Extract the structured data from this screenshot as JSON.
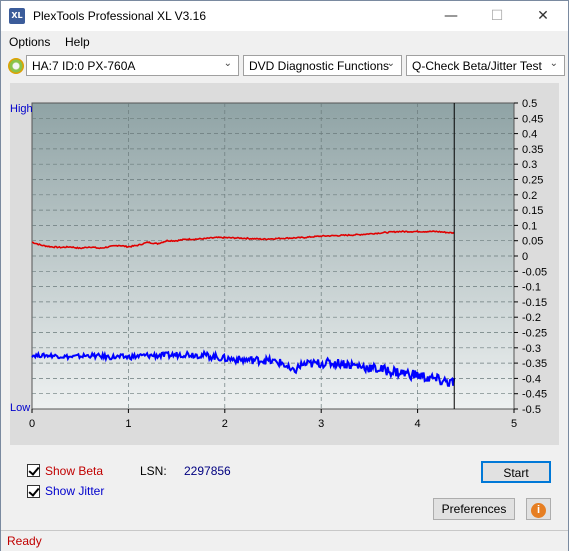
{
  "window": {
    "title": "PlexTools Professional XL V3.16",
    "app_icon_text": "XL"
  },
  "menu": {
    "options": "Options",
    "help": "Help"
  },
  "toolbar": {
    "drive": "HA:7 ID:0  PX-760A",
    "function": "DVD Diagnostic Functions",
    "test": "Q-Check Beta/Jitter Test"
  },
  "controls": {
    "show_beta": "Show Beta",
    "show_jitter": "Show Jitter",
    "show_beta_checked": true,
    "show_jitter_checked": true,
    "lsn_label": "LSN:",
    "lsn_value": "2297856",
    "start": "Start",
    "preferences": "Preferences"
  },
  "status": {
    "text": "Ready"
  },
  "colors": {
    "beta": "#e00000",
    "jitter": "#0000ff",
    "plot_top": "#8fa3a5",
    "plot_bottom": "#e8ecec",
    "left_label": "#0000cc"
  },
  "chart_data": {
    "type": "line",
    "left_axis_labels": {
      "high": "High",
      "low": "Low"
    },
    "x_ticks": [
      "0",
      "1",
      "2",
      "3",
      "4",
      "5"
    ],
    "xlim": [
      0,
      5
    ],
    "y_ticks": [
      "0.5",
      "0.45",
      "0.4",
      "0.35",
      "0.3",
      "0.25",
      "0.2",
      "0.15",
      "0.1",
      "0.05",
      "0",
      "-0.05",
      "-0.1",
      "-0.15",
      "-0.2",
      "-0.25",
      "-0.3",
      "-0.35",
      "-0.4",
      "-0.45",
      "-0.5"
    ],
    "ylim": [
      -0.5,
      0.5
    ],
    "end_marker_x": 4.38,
    "series": [
      {
        "color": "#e00000",
        "x": [
          0,
          0.1,
          0.2,
          0.3,
          0.4,
          0.5,
          0.6,
          0.7,
          0.8,
          0.9,
          1.0,
          1.1,
          1.2,
          1.3,
          1.4,
          1.5,
          1.6,
          1.7,
          1.8,
          1.9,
          2.0,
          2.2,
          2.4,
          2.6,
          2.8,
          3.0,
          3.2,
          3.4,
          3.6,
          3.8,
          4.0,
          4.2,
          4.38
        ],
        "values": [
          0.045,
          0.035,
          0.03,
          0.028,
          0.03,
          0.025,
          0.03,
          0.025,
          0.03,
          0.035,
          0.03,
          0.035,
          0.045,
          0.04,
          0.05,
          0.05,
          0.055,
          0.055,
          0.057,
          0.06,
          0.06,
          0.058,
          0.055,
          0.058,
          0.06,
          0.065,
          0.067,
          0.07,
          0.075,
          0.08,
          0.08,
          0.08,
          0.075
        ]
      },
      {
        "color": "#0000ff",
        "x": [
          0,
          0.2,
          0.4,
          0.6,
          0.8,
          1.0,
          1.2,
          1.4,
          1.6,
          1.8,
          2.0,
          2.2,
          2.4,
          2.6,
          2.7,
          2.8,
          3.0,
          3.2,
          3.4,
          3.6,
          3.8,
          4.0,
          4.2,
          4.38
        ],
        "values": [
          -0.325,
          -0.325,
          -0.33,
          -0.325,
          -0.33,
          -0.33,
          -0.325,
          -0.325,
          -0.32,
          -0.325,
          -0.335,
          -0.34,
          -0.34,
          -0.35,
          -0.38,
          -0.355,
          -0.35,
          -0.35,
          -0.36,
          -0.37,
          -0.38,
          -0.39,
          -0.405,
          -0.415
        ]
      }
    ]
  }
}
